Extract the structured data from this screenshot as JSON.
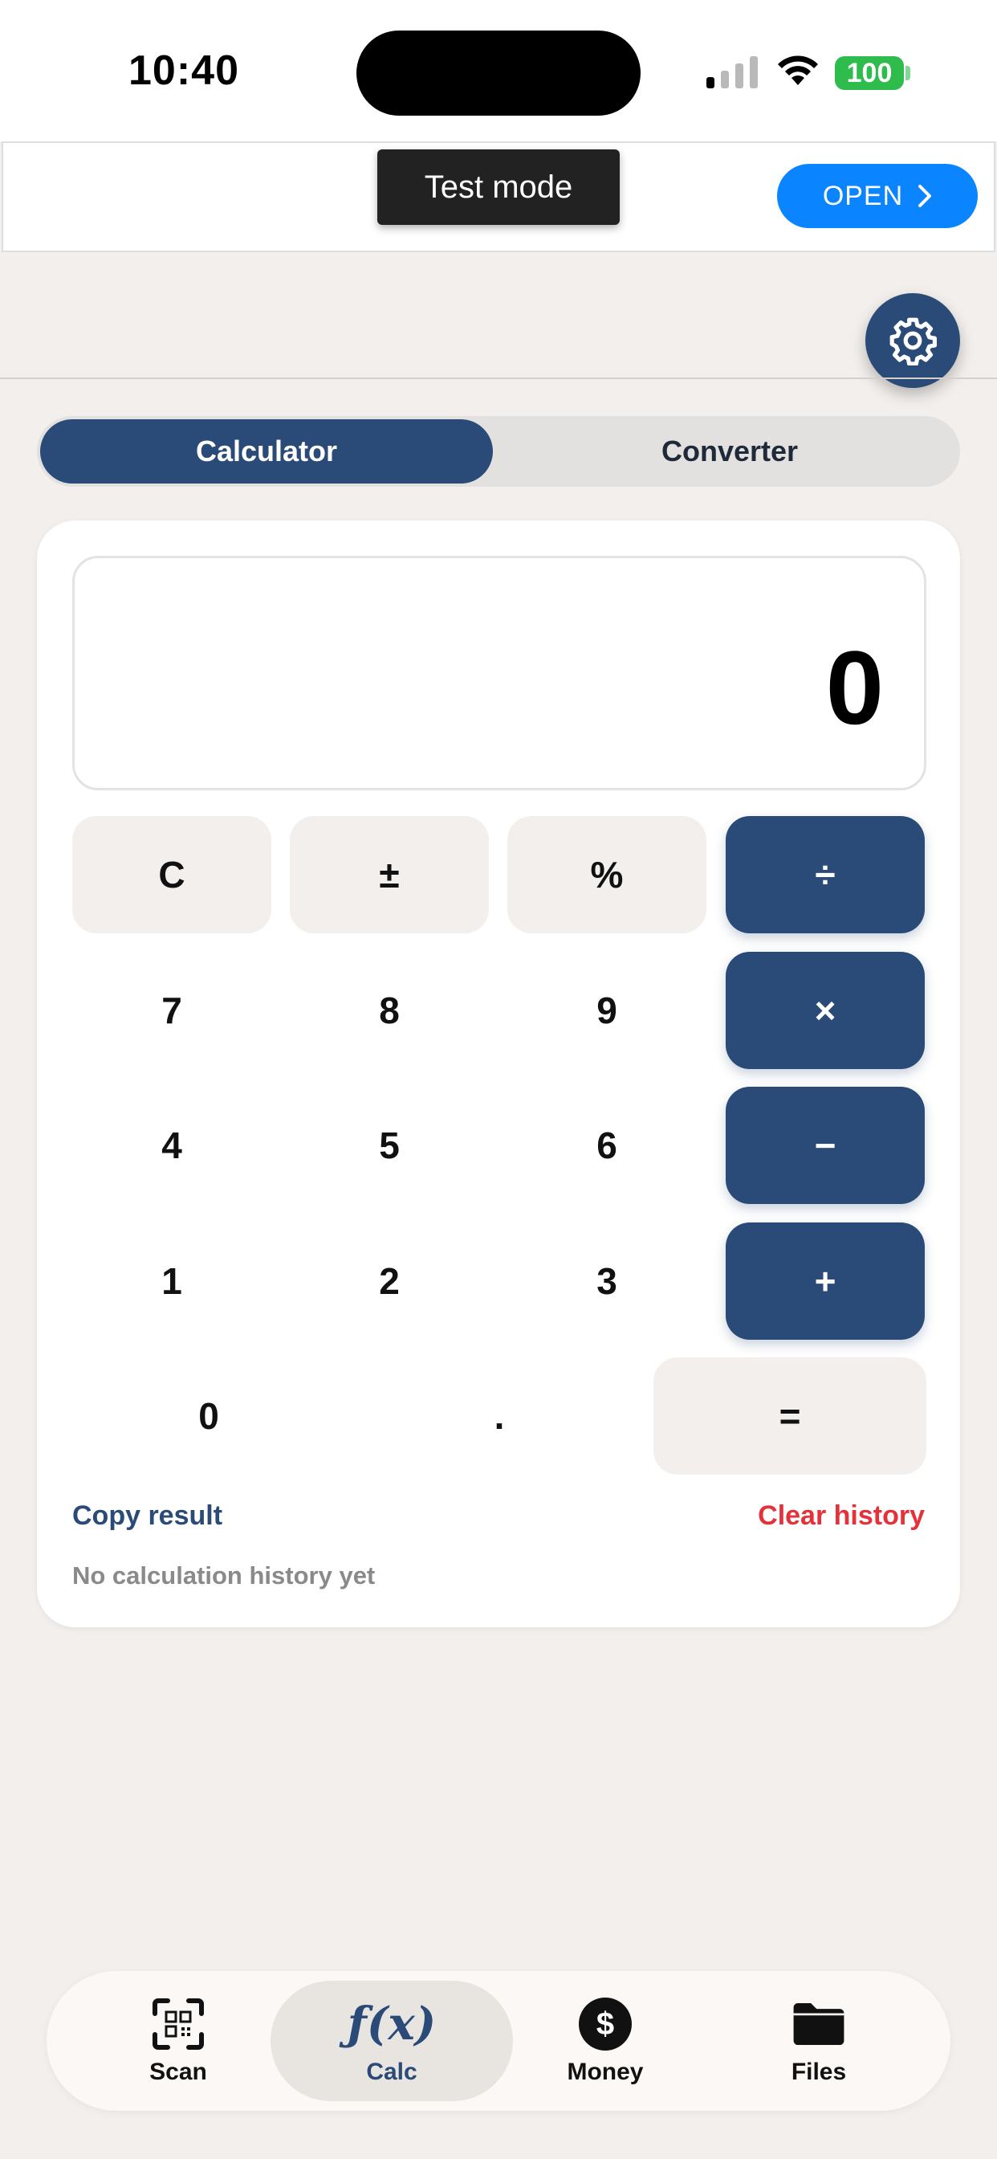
{
  "status_bar": {
    "time": "10:40",
    "battery": "100",
    "icons": [
      "signal-icon",
      "wifi-icon",
      "battery-icon"
    ]
  },
  "ad": {
    "badge": "Test mode",
    "open_label": "OPEN"
  },
  "settings": {
    "icon": "gear-icon"
  },
  "segmented": {
    "tabs": [
      {
        "label": "Calculator",
        "selected": true
      },
      {
        "label": "Converter",
        "selected": false
      }
    ]
  },
  "calculator": {
    "display_value": "0",
    "keys": {
      "clear": "C",
      "sign": "±",
      "percent": "%",
      "divide": "÷",
      "seven": "7",
      "eight": "8",
      "nine": "9",
      "multiply": "×",
      "four": "4",
      "five": "5",
      "six": "6",
      "minus": "−",
      "one": "1",
      "two": "2",
      "three": "3",
      "plus": "+",
      "zero": "0",
      "dot": ".",
      "equals": "="
    },
    "copy_result": "Copy result",
    "clear_history": "Clear history",
    "history_empty": "No calculation history yet"
  },
  "bottom_nav": {
    "items": [
      {
        "label": "Scan",
        "icon": "qr-scan-icon"
      },
      {
        "label": "Calc",
        "icon": "function-icon",
        "active": true,
        "glyph": "ƒ(x)"
      },
      {
        "label": "Money",
        "icon": "dollar-icon",
        "glyph": "$"
      },
      {
        "label": "Files",
        "icon": "folder-icon"
      }
    ]
  },
  "colors": {
    "primary": "#2a4a78",
    "background": "#f2efec",
    "danger": "#e5323a",
    "ad_button": "#0a84ff",
    "battery": "#2ebd4d"
  }
}
